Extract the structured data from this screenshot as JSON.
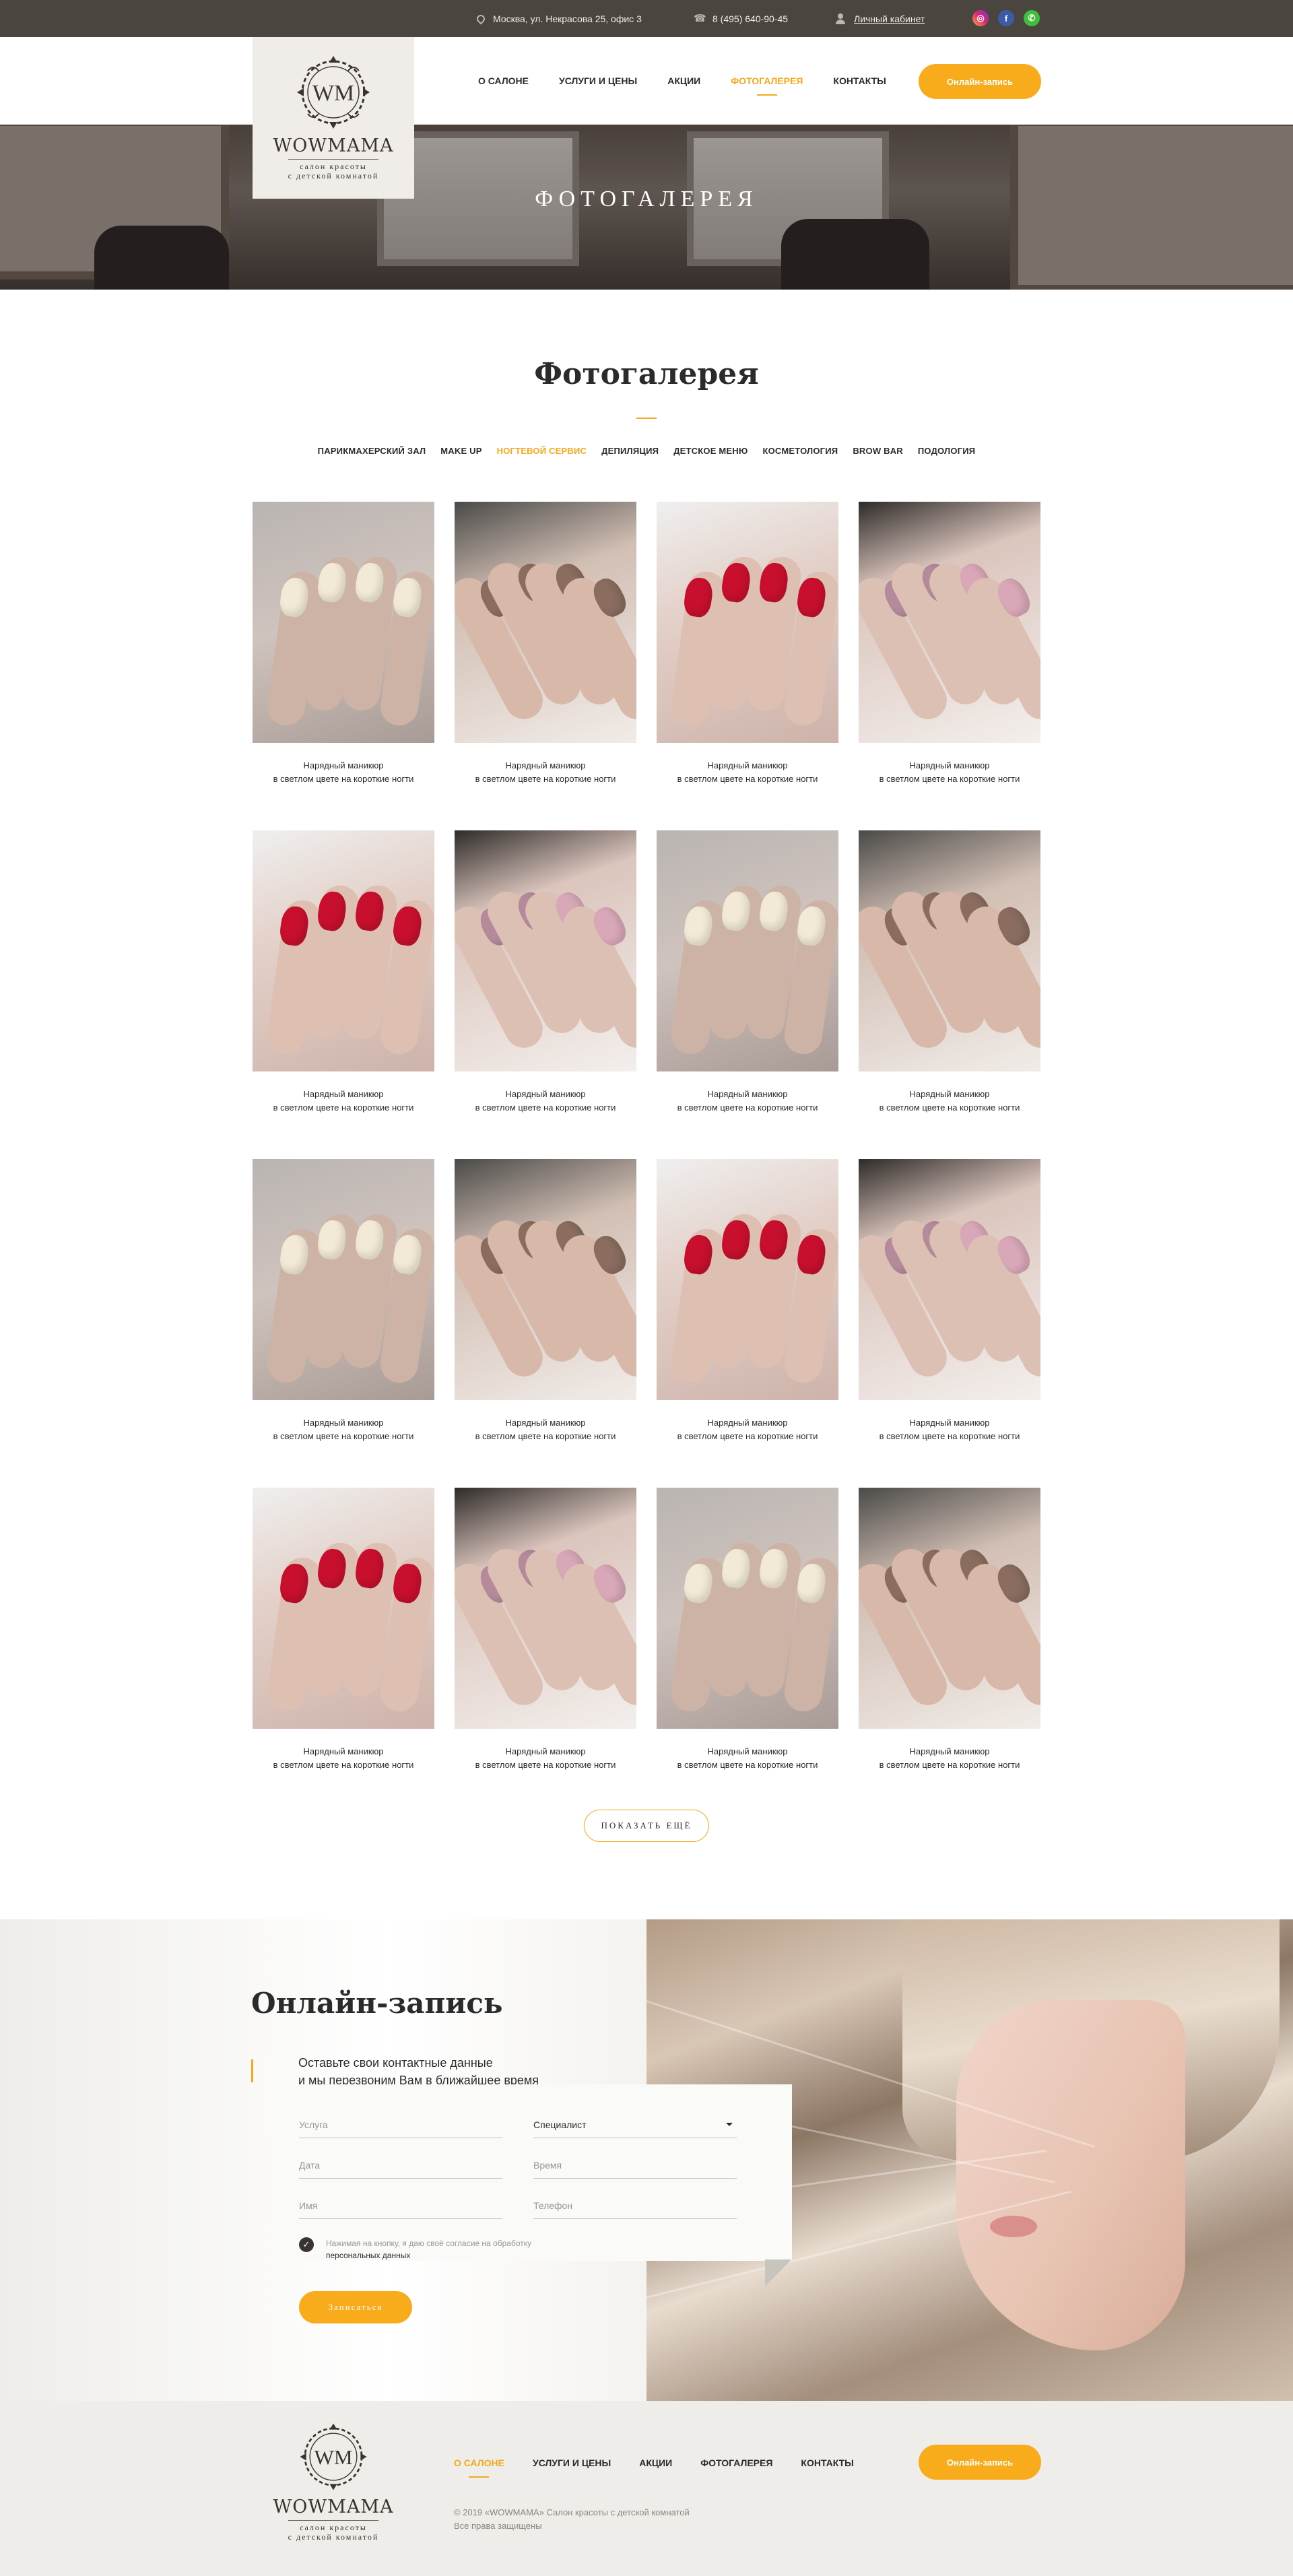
{
  "topbar": {
    "address": "Москва, ул. Некрасова 25, офис 3",
    "phone": "8 (495) 640-90-45",
    "cabinet": "Личный кабинет",
    "social": [
      "instagram-icon",
      "facebook-icon",
      "whatsapp-icon"
    ],
    "social_glyphs": [
      "◎",
      "f",
      "✆"
    ]
  },
  "logo": {
    "monogram": "WM",
    "word": "WOWMAMA",
    "sub_line1": "салон красоты",
    "sub_line2": "с детской комнатой"
  },
  "nav": {
    "items": [
      "О салоне",
      "Услуги и цены",
      "Акции",
      "Фотогалерея",
      "Контакты"
    ],
    "active_index": 3,
    "cta": "Онлайн-запись"
  },
  "hero": {
    "title": "Фотогалерея"
  },
  "gallery": {
    "title": "Фотогалерея",
    "filters": [
      "Парикмахерский зал",
      "Make up",
      "Ногтевой сервис",
      "Депиляция",
      "Детское меню",
      "Косметология",
      "Brow bar",
      "Подология"
    ],
    "active_filter": 2,
    "caption_line1": "Нарядный маникюр",
    "caption_line2": "в светлом цвете на короткие ногти",
    "more_button": "Показать ещё"
  },
  "booking": {
    "title": "Онлайн-запись",
    "subtitle_line1": "Оставьте свои контактные данные",
    "subtitle_line2": "и мы перезвоним Вам в ближайшее время",
    "fields": {
      "service": "Услуга",
      "specialist": "Специалист",
      "date": "Дата",
      "time": "Время",
      "name": "Имя",
      "phone": "Телефон"
    },
    "consent_line1": "Нажимая на кнопку, я даю своё согласие на обработку",
    "consent_line2": "персональных данных",
    "submit": "Записаться"
  },
  "footer": {
    "nav": [
      "О салоне",
      "Услуги и цены",
      "Акции",
      "Фотогалерея",
      "Контакты"
    ],
    "active_index": 0,
    "copyright_line1": "© 2019 «WOWMAMA» Салон красоты с детской комнатой",
    "copyright_line2": "Все права защищены",
    "cta": "Онлайн-запись"
  },
  "colors": {
    "accent": "#f8ac1c",
    "topbar": "#4b4540",
    "dark_text": "#2b2b2b",
    "beige": "#efede9"
  }
}
